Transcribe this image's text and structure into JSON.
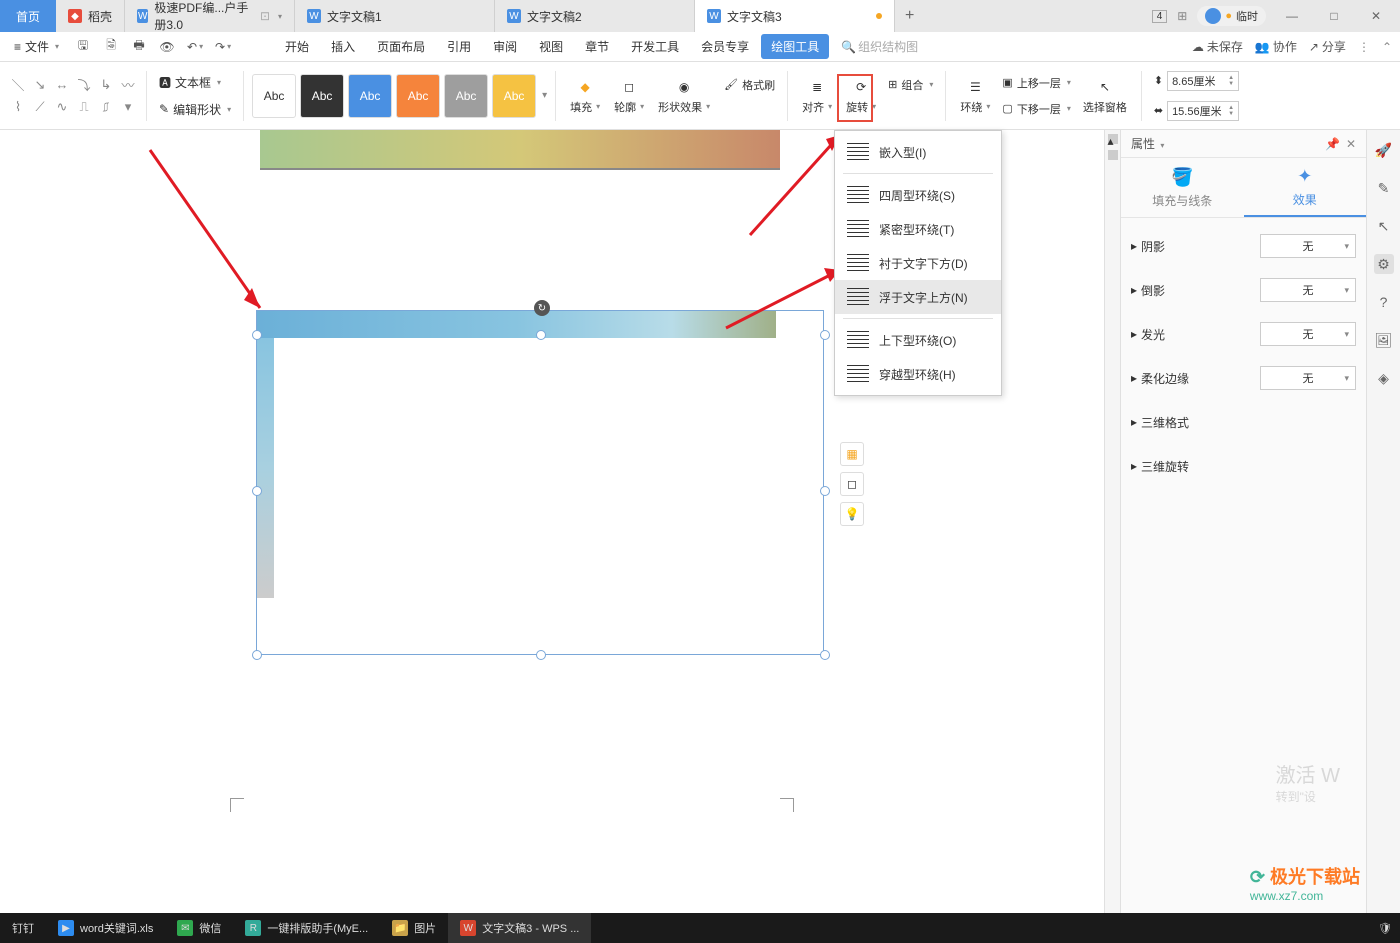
{
  "titlebar": {
    "home": "首页",
    "tabs": [
      {
        "label": "稻壳",
        "icon": "red"
      },
      {
        "label": "极速PDF编...户手册3.0",
        "icon": "blue"
      },
      {
        "label": "文字文稿1",
        "icon": "blue"
      },
      {
        "label": "文字文稿2",
        "icon": "blue"
      },
      {
        "label": "文字文稿3",
        "icon": "blue",
        "dirty": true,
        "active": true
      }
    ],
    "badge": "4",
    "pill": "临时"
  },
  "menubar": {
    "file": "文件",
    "tabs": [
      "开始",
      "插入",
      "页面布局",
      "引用",
      "审阅",
      "视图",
      "章节",
      "开发工具",
      "会员专享",
      "绘图工具"
    ],
    "org_chart": "组织结构图",
    "unsaved": "未保存",
    "collab": "协作",
    "share": "分享"
  },
  "ribbon": {
    "text_box": "文本框",
    "edit_shape": "编辑形状",
    "style_label": "Abc",
    "fill": "填充",
    "outline": "轮廓",
    "shape_effect": "形状效果",
    "format_painter": "格式刷",
    "align": "对齐",
    "rotate": "旋转",
    "group": "组合",
    "wrap": "环绕",
    "bring_forward": "上移一层",
    "send_backward": "下移一层",
    "selection_pane": "选择窗格",
    "width_value": "8.65厘米",
    "height_value": "15.56厘米"
  },
  "wrap_menu": {
    "items": [
      "嵌入型(I)",
      "四周型环绕(S)",
      "紧密型环绕(T)",
      "衬于文字下方(D)",
      "浮于文字上方(N)",
      "上下型环绕(O)",
      "穿越型环绕(H)"
    ]
  },
  "side": {
    "title": "属性",
    "tab_fill": "填充与线条",
    "tab_effect": "效果",
    "rows": [
      "阴影",
      "倒影",
      "发光",
      "柔化边缘",
      "三维格式",
      "三维旋转"
    ],
    "none": "无"
  },
  "watermark": {
    "activate": "激活 W",
    "goto": "转到\"设",
    "site_cn": "极光下载站",
    "site_url": "www.xz7.com"
  },
  "taskbar": {
    "items": [
      {
        "label": "钉钉",
        "color": "#2b7"
      },
      {
        "label": "word关键词.xls",
        "color": "#2d8cf0"
      },
      {
        "label": "微信",
        "color": "#2fa84f"
      },
      {
        "label": "一键排版助手(MyE...",
        "color": "#3a9"
      },
      {
        "label": "图片",
        "color": "#c9a24a"
      },
      {
        "label": "文字文稿3 - WPS ...",
        "color": "#d8452e"
      }
    ]
  }
}
